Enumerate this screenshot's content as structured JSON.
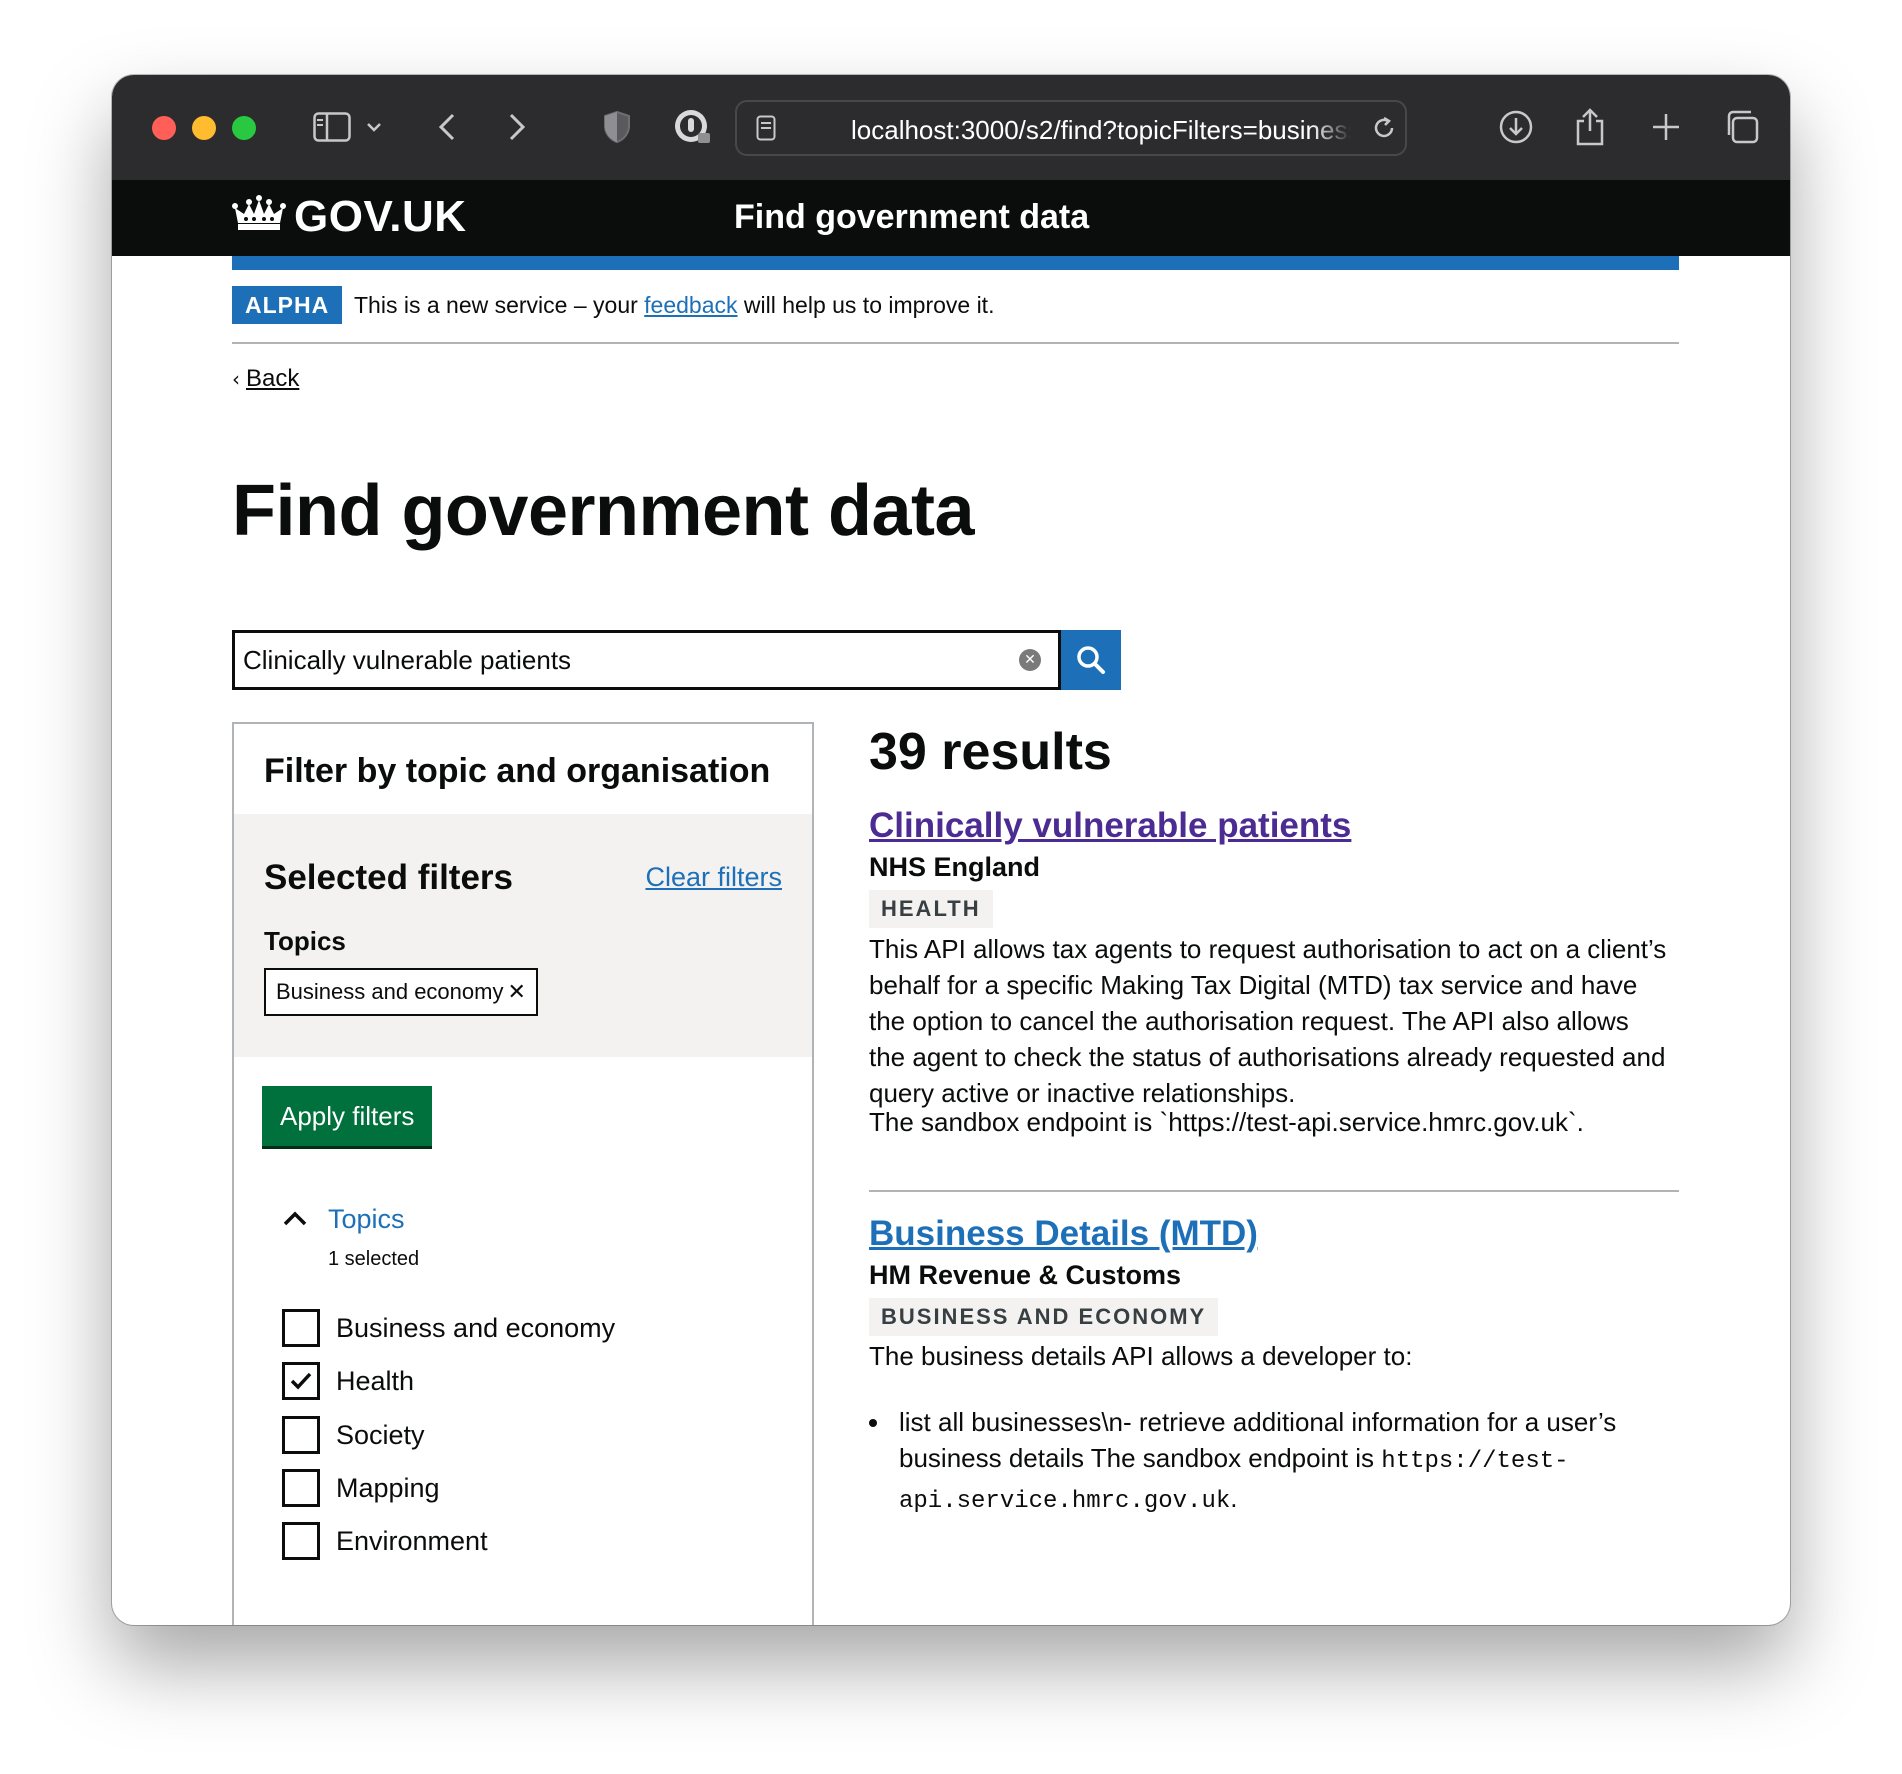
{
  "browser": {
    "url": "localhost:3000/s2/find?topicFilters=business",
    "icons": [
      "sidebar-icon",
      "chevron-down-icon",
      "back-icon",
      "forward-icon",
      "shield-icon",
      "password-icon",
      "page-icon",
      "reload-icon",
      "download-icon",
      "share-icon",
      "new-tab-icon",
      "tabs-overview-icon"
    ]
  },
  "header": {
    "logo_text": "GOV.UK",
    "service_name": "Find government data"
  },
  "phase_banner": {
    "tag": "ALPHA",
    "text_before": "This is a new service – your ",
    "link": "feedback",
    "text_after": " will help us to improve it."
  },
  "back_link": "Back",
  "page_title": "Find government data",
  "search": {
    "value": "Clinically vulnerable patients",
    "button_icon": "search-icon"
  },
  "filters": {
    "title": "Filter by topic and organisation",
    "selected_title": "Selected filters",
    "clear_label": "Clear filters",
    "topics_heading": "Topics",
    "chips": [
      "Business and economy"
    ],
    "apply_label": "Apply filters",
    "accordion": {
      "title": "Topics",
      "subtitle": "1 selected",
      "options": [
        {
          "label": "Business and economy",
          "checked": false
        },
        {
          "label": "Health",
          "checked": true
        },
        {
          "label": "Society",
          "checked": false
        },
        {
          "label": "Mapping",
          "checked": false
        },
        {
          "label": "Environment",
          "checked": false
        }
      ]
    }
  },
  "results": {
    "count_label": "39 results",
    "items": [
      {
        "title": "Clinically vulnerable patients",
        "visited": true,
        "organisation": "NHS England",
        "tag": "HEALTH",
        "description": "This API allows tax agents to request authorisation to act on a client’s behalf for a specific Making Tax Digital (MTD) tax service and have the option to cancel the authorisation request. The API also allows the agent to check the status of authorisations already requested and query active or inactive relationships.",
        "description_2": "The sandbox endpoint is `https://test-api.service.hmrc.gov.uk`."
      },
      {
        "title": "Business Details (MTD)",
        "visited": false,
        "organisation": "HM Revenue & Customs",
        "tag": "BUSINESS AND ECONOMY",
        "description": "The business details API allows a developer to:",
        "bullet_text": "list all businesses\\n- retrieve additional information for a user’s business details The sandbox endpoint is ",
        "bullet_code": "https://test-api.service.hmrc.gov.uk",
        "bullet_end": "."
      }
    ]
  }
}
